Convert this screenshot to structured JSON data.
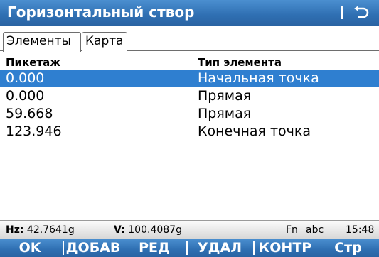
{
  "window": {
    "title": "Горизонтальный створ",
    "back_icon": "back-arrow-icon"
  },
  "tabs": [
    {
      "label": "Элементы",
      "active": true
    },
    {
      "label": "Карта",
      "active": false
    }
  ],
  "table": {
    "columns": [
      "Пикетаж",
      "Тип элемента"
    ],
    "rows": [
      {
        "station": "0.000",
        "type": "Начальная точка",
        "selected": true
      },
      {
        "station": "0.000",
        "type": "Прямая",
        "selected": false
      },
      {
        "station": "59.668",
        "type": "Прямая",
        "selected": false
      },
      {
        "station": "123.946",
        "type": "Конечная точка",
        "selected": false
      }
    ]
  },
  "status": {
    "hz_label": "Hz:",
    "hz_value": "42.7641g",
    "v_label": "V:",
    "v_value": "100.4087g",
    "fn": "Fn",
    "input_mode": "abc",
    "time": "15:48"
  },
  "softkeys": [
    "OK",
    "ДОБАВ",
    "РЕД",
    "УДАЛ",
    "КОНТР",
    "Стр"
  ],
  "colors": {
    "accent": "#2f6fb2",
    "selection": "#2f7fd0"
  }
}
